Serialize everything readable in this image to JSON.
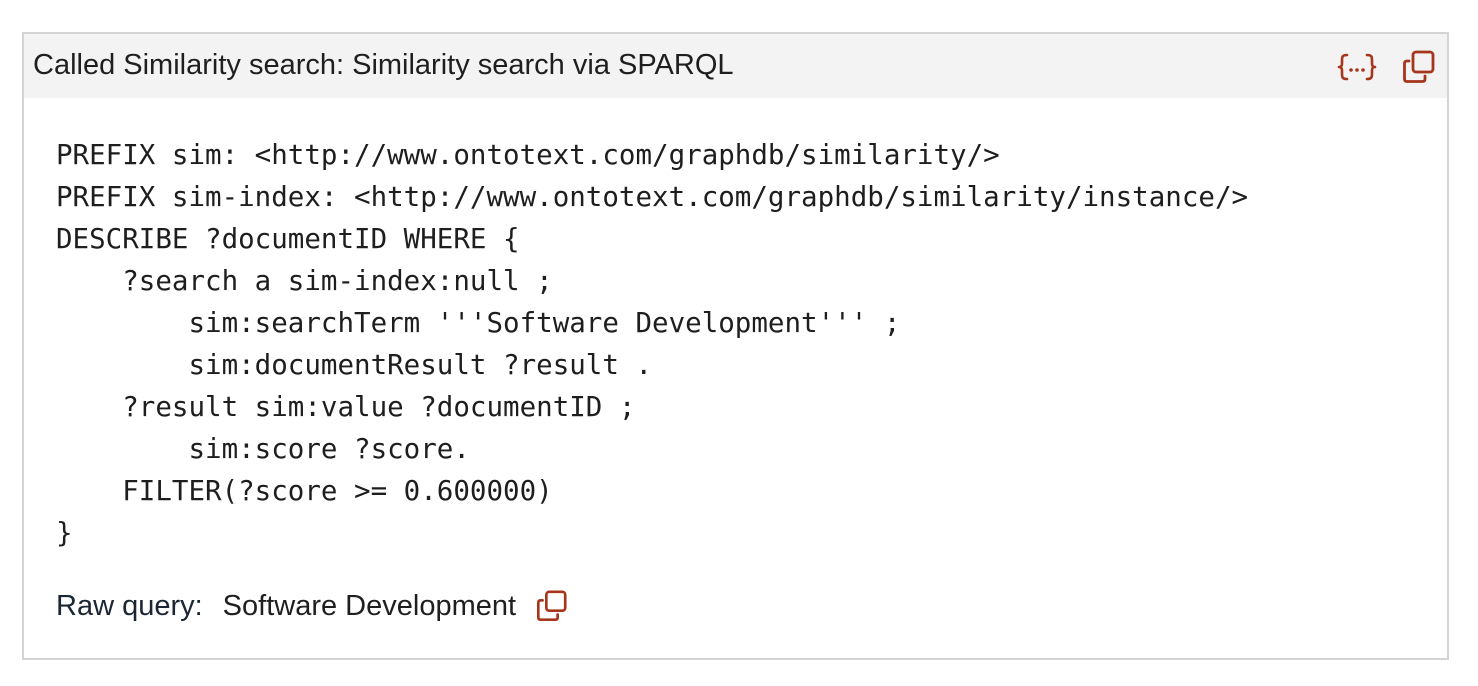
{
  "panel": {
    "title": "Called Similarity search: Similarity search via SPARQL",
    "actions": {
      "view_json_icon": "curly-braces-ellipsis-icon",
      "copy_icon": "copy-icon"
    }
  },
  "code": {
    "language": "SPARQL",
    "text": "PREFIX sim: <http://www.ontotext.com/graphdb/similarity/>\nPREFIX sim-index: <http://www.ontotext.com/graphdb/similarity/instance/>\nDESCRIBE ?documentID WHERE {\n    ?search a sim-index:null ;\n        sim:searchTerm '''Software Development''' ;\n        sim:documentResult ?result .\n    ?result sim:value ?documentID ;\n        sim:score ?score.\n    FILTER(?score >= 0.600000)\n}"
  },
  "raw_query": {
    "label": "Raw query:",
    "value": "Software Development",
    "copy_icon": "copy-icon"
  },
  "colors": {
    "accent": "#a5361b",
    "header_bg": "#f3f3f3",
    "border": "#d4d4d4"
  }
}
